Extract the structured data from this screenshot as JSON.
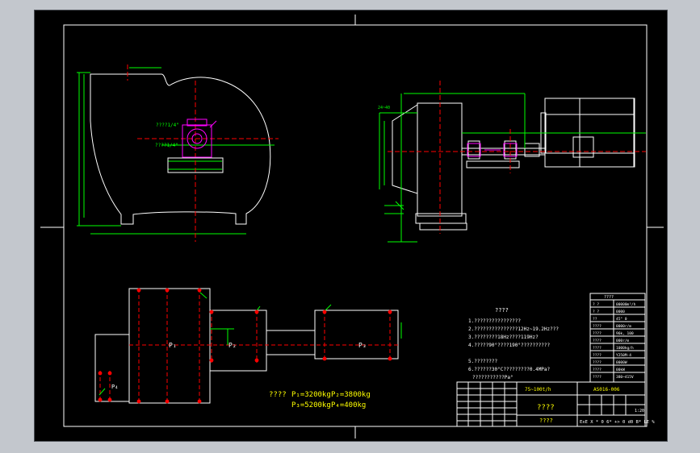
{
  "drawing": {
    "notes_title": "????",
    "notes": [
      "1.????????????????",
      "2.???????????????12Hz~19.2Hz???",
      "3.????????18Hz????119Hz?",
      "4.?????90°????190°??????????",
      "5.????????",
      "6.??????30°C?????????0.4MPa?",
      "???????????Pa°"
    ],
    "loads": {
      "prefix": "????",
      "p1": "P₁=3200kg",
      "p2": "P₂=3800kg",
      "p3": "P₃=5200kg",
      "p4": "P₄=400kg"
    },
    "plan_labels": {
      "p1": "P₁",
      "p2": "P₂",
      "p3": "P₃",
      "p4": "P₄"
    },
    "side_labels": {
      "upper": "????1/4\"",
      "lower": "????1/4\""
    },
    "dim_labels": {
      "left_small": "24~40"
    },
    "title_block": {
      "project": "75~100t/h",
      "drawing_no": "AS016-006",
      "name": "????",
      "sub": "????",
      "scale": "1:20",
      "footer": "ExE X * 0 6* +> 0 d0 B* LE %"
    },
    "param_table": {
      "header": "????",
      "rows": [
        {
          "k": "? ?",
          "v": "00000m³/h"
        },
        {
          "k": "? ?",
          "v": "0000"
        },
        {
          "k": "??",
          "v": "45° 0"
        },
        {
          "k": "????",
          "v": "0000r/m"
        },
        {
          "k": "????",
          "v": "96k, 100"
        },
        {
          "k": "????",
          "v": "000r/m"
        },
        {
          "k": "????",
          "v": "1000kg/h"
        },
        {
          "k": "????",
          "v": "Y250M-4"
        },
        {
          "k": "????",
          "v": "0000W"
        },
        {
          "k": "????",
          "v": "00kW"
        },
        {
          "k": "????",
          "v": "380~415V"
        }
      ]
    },
    "colors": {
      "lines": "#ffffff",
      "green": "#00ff00",
      "magenta": "#ff00ff",
      "yellow": "#ffff00",
      "red": "#ff0000",
      "cyan": "#00ffff"
    }
  }
}
